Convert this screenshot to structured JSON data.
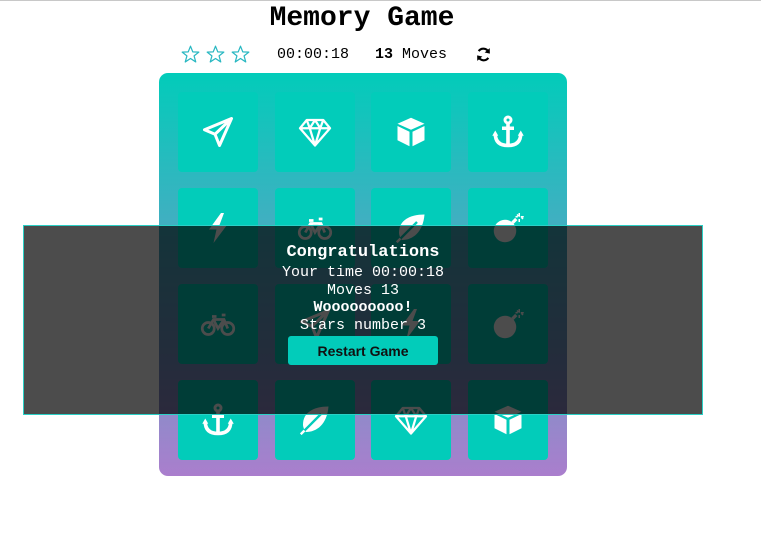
{
  "title": "Memory Game",
  "score_panel": {
    "stars": [
      "star-outline-icon",
      "star-outline-icon",
      "star-outline-icon"
    ],
    "timer": "00:00:18",
    "moves_count": "13",
    "moves_label": " Moves",
    "restart_icon": "restart-icon"
  },
  "colors": {
    "card": "#02ccba",
    "deck_gradient_top": "#02ccba",
    "deck_gradient_bottom": "#aa7ecd",
    "overlay": "rgba(0,0,0,0.7)",
    "accent": "#2ad0c6"
  },
  "deck": {
    "cards": [
      {
        "icon": "paper-plane-icon"
      },
      {
        "icon": "diamond-icon"
      },
      {
        "icon": "cube-icon"
      },
      {
        "icon": "anchor-icon"
      },
      {
        "icon": "bolt-icon"
      },
      {
        "icon": "bicycle-icon"
      },
      {
        "icon": "leaf-icon"
      },
      {
        "icon": "bomb-icon"
      },
      {
        "icon": "bicycle-icon"
      },
      {
        "icon": "paper-plane-icon"
      },
      {
        "icon": "bolt-icon"
      },
      {
        "icon": "bomb-icon"
      },
      {
        "icon": "anchor-icon"
      },
      {
        "icon": "leaf-icon"
      },
      {
        "icon": "diamond-icon"
      },
      {
        "icon": "cube-icon"
      }
    ]
  },
  "modal": {
    "title": "Congratulations",
    "time_text": "Your time 00:00:18",
    "moves_text": "Moves 13",
    "message": "Wooooooooo!",
    "stars_text": "Stars number 3",
    "button_label": "Restart Game"
  }
}
